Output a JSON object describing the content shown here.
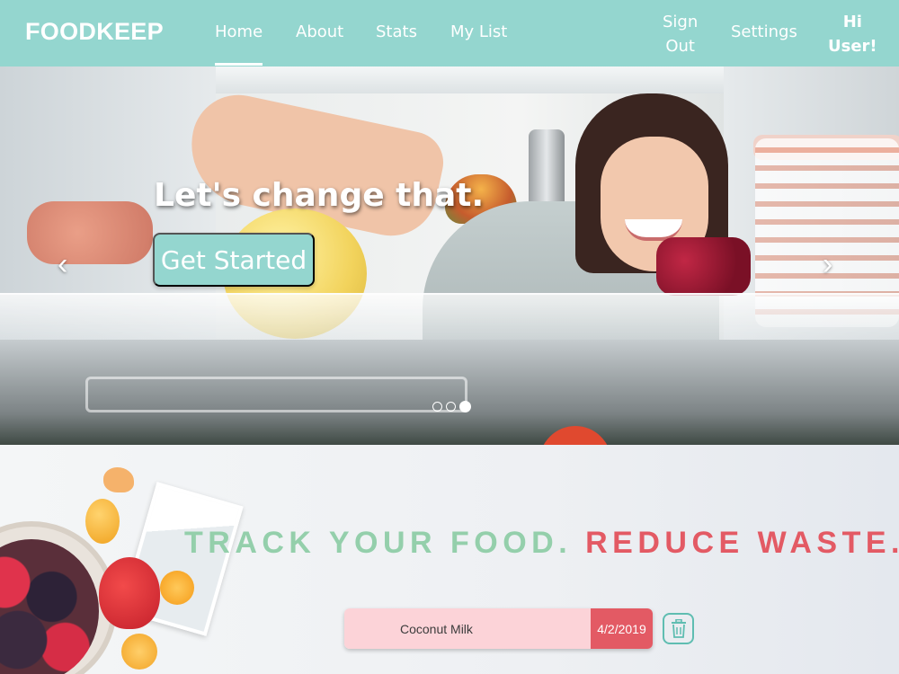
{
  "nav": {
    "brand": "FOODKEEP",
    "links": [
      {
        "label": "Home",
        "active": true
      },
      {
        "label": "About"
      },
      {
        "label": "Stats"
      },
      {
        "label": "My List"
      }
    ],
    "sign_out_line1": "Sign",
    "sign_out_line2": "Out",
    "settings": "Settings",
    "greeting_line1": "Hi",
    "greeting_line2": "User!"
  },
  "hero": {
    "heading": "Let's change that.",
    "cta_label": "Get Started",
    "prev_arrow": "‹",
    "next_arrow": "›",
    "slides_count": 3,
    "active_slide": 3
  },
  "tagline": {
    "part1": "TRACK YOUR FOOD.",
    "part2": "REDUCE WASTE."
  },
  "food_list": [
    {
      "name": "Coconut Milk",
      "date": "4/2/2019"
    }
  ],
  "colors": {
    "teal": "#94d6cf",
    "green_text": "#94cfab",
    "red": "#e35a64",
    "pink": "#fcd3d8"
  }
}
